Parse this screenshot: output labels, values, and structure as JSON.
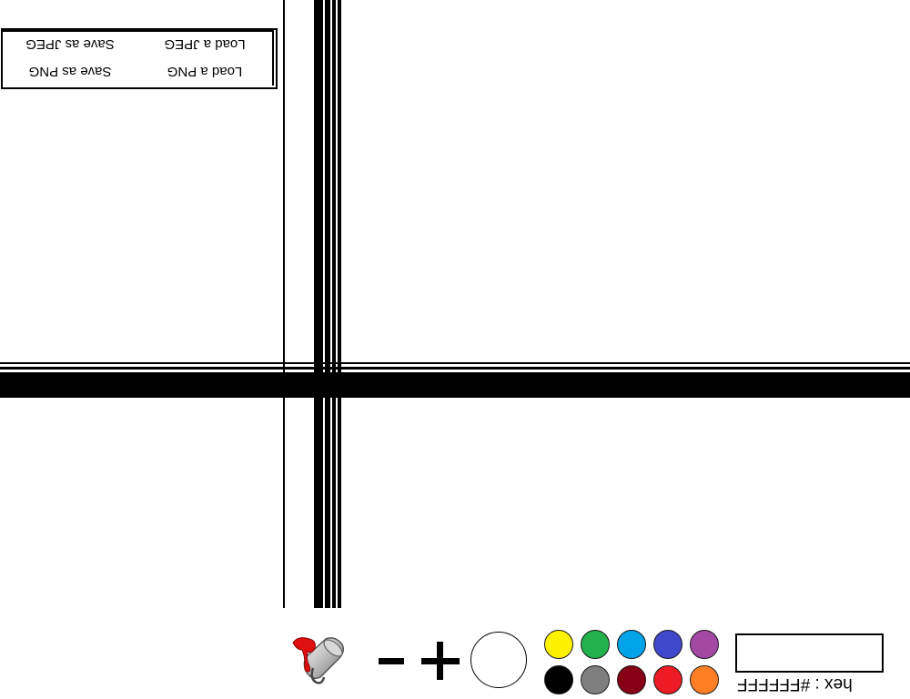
{
  "file_menu": {
    "save_jpeg": "Save as JPEG",
    "load_jpeg": "Load a JPEG",
    "save_png": "Save as PNG",
    "load_png": "Load a PNG"
  },
  "tools": {
    "fill_icon": "paint-bucket-icon",
    "decrease_size_icon": "minus-icon",
    "increase_size_icon": "plus-icon"
  },
  "brush": {
    "current_color": "#FFFFFF"
  },
  "palette": [
    {
      "name": "yellow",
      "color": "#FFF200"
    },
    {
      "name": "green",
      "color": "#22B14C"
    },
    {
      "name": "sky-blue",
      "color": "#00A2E8"
    },
    {
      "name": "blue",
      "color": "#3F48CC"
    },
    {
      "name": "purple",
      "color": "#A349A4"
    },
    {
      "name": "black",
      "color": "#000000"
    },
    {
      "name": "gray",
      "color": "#7F7F7F"
    },
    {
      "name": "dark-red",
      "color": "#880015"
    },
    {
      "name": "red",
      "color": "#ED1C24"
    },
    {
      "name": "orange",
      "color": "#FF7F27"
    }
  ],
  "hex": {
    "label": "hex : #FFFFFF"
  }
}
